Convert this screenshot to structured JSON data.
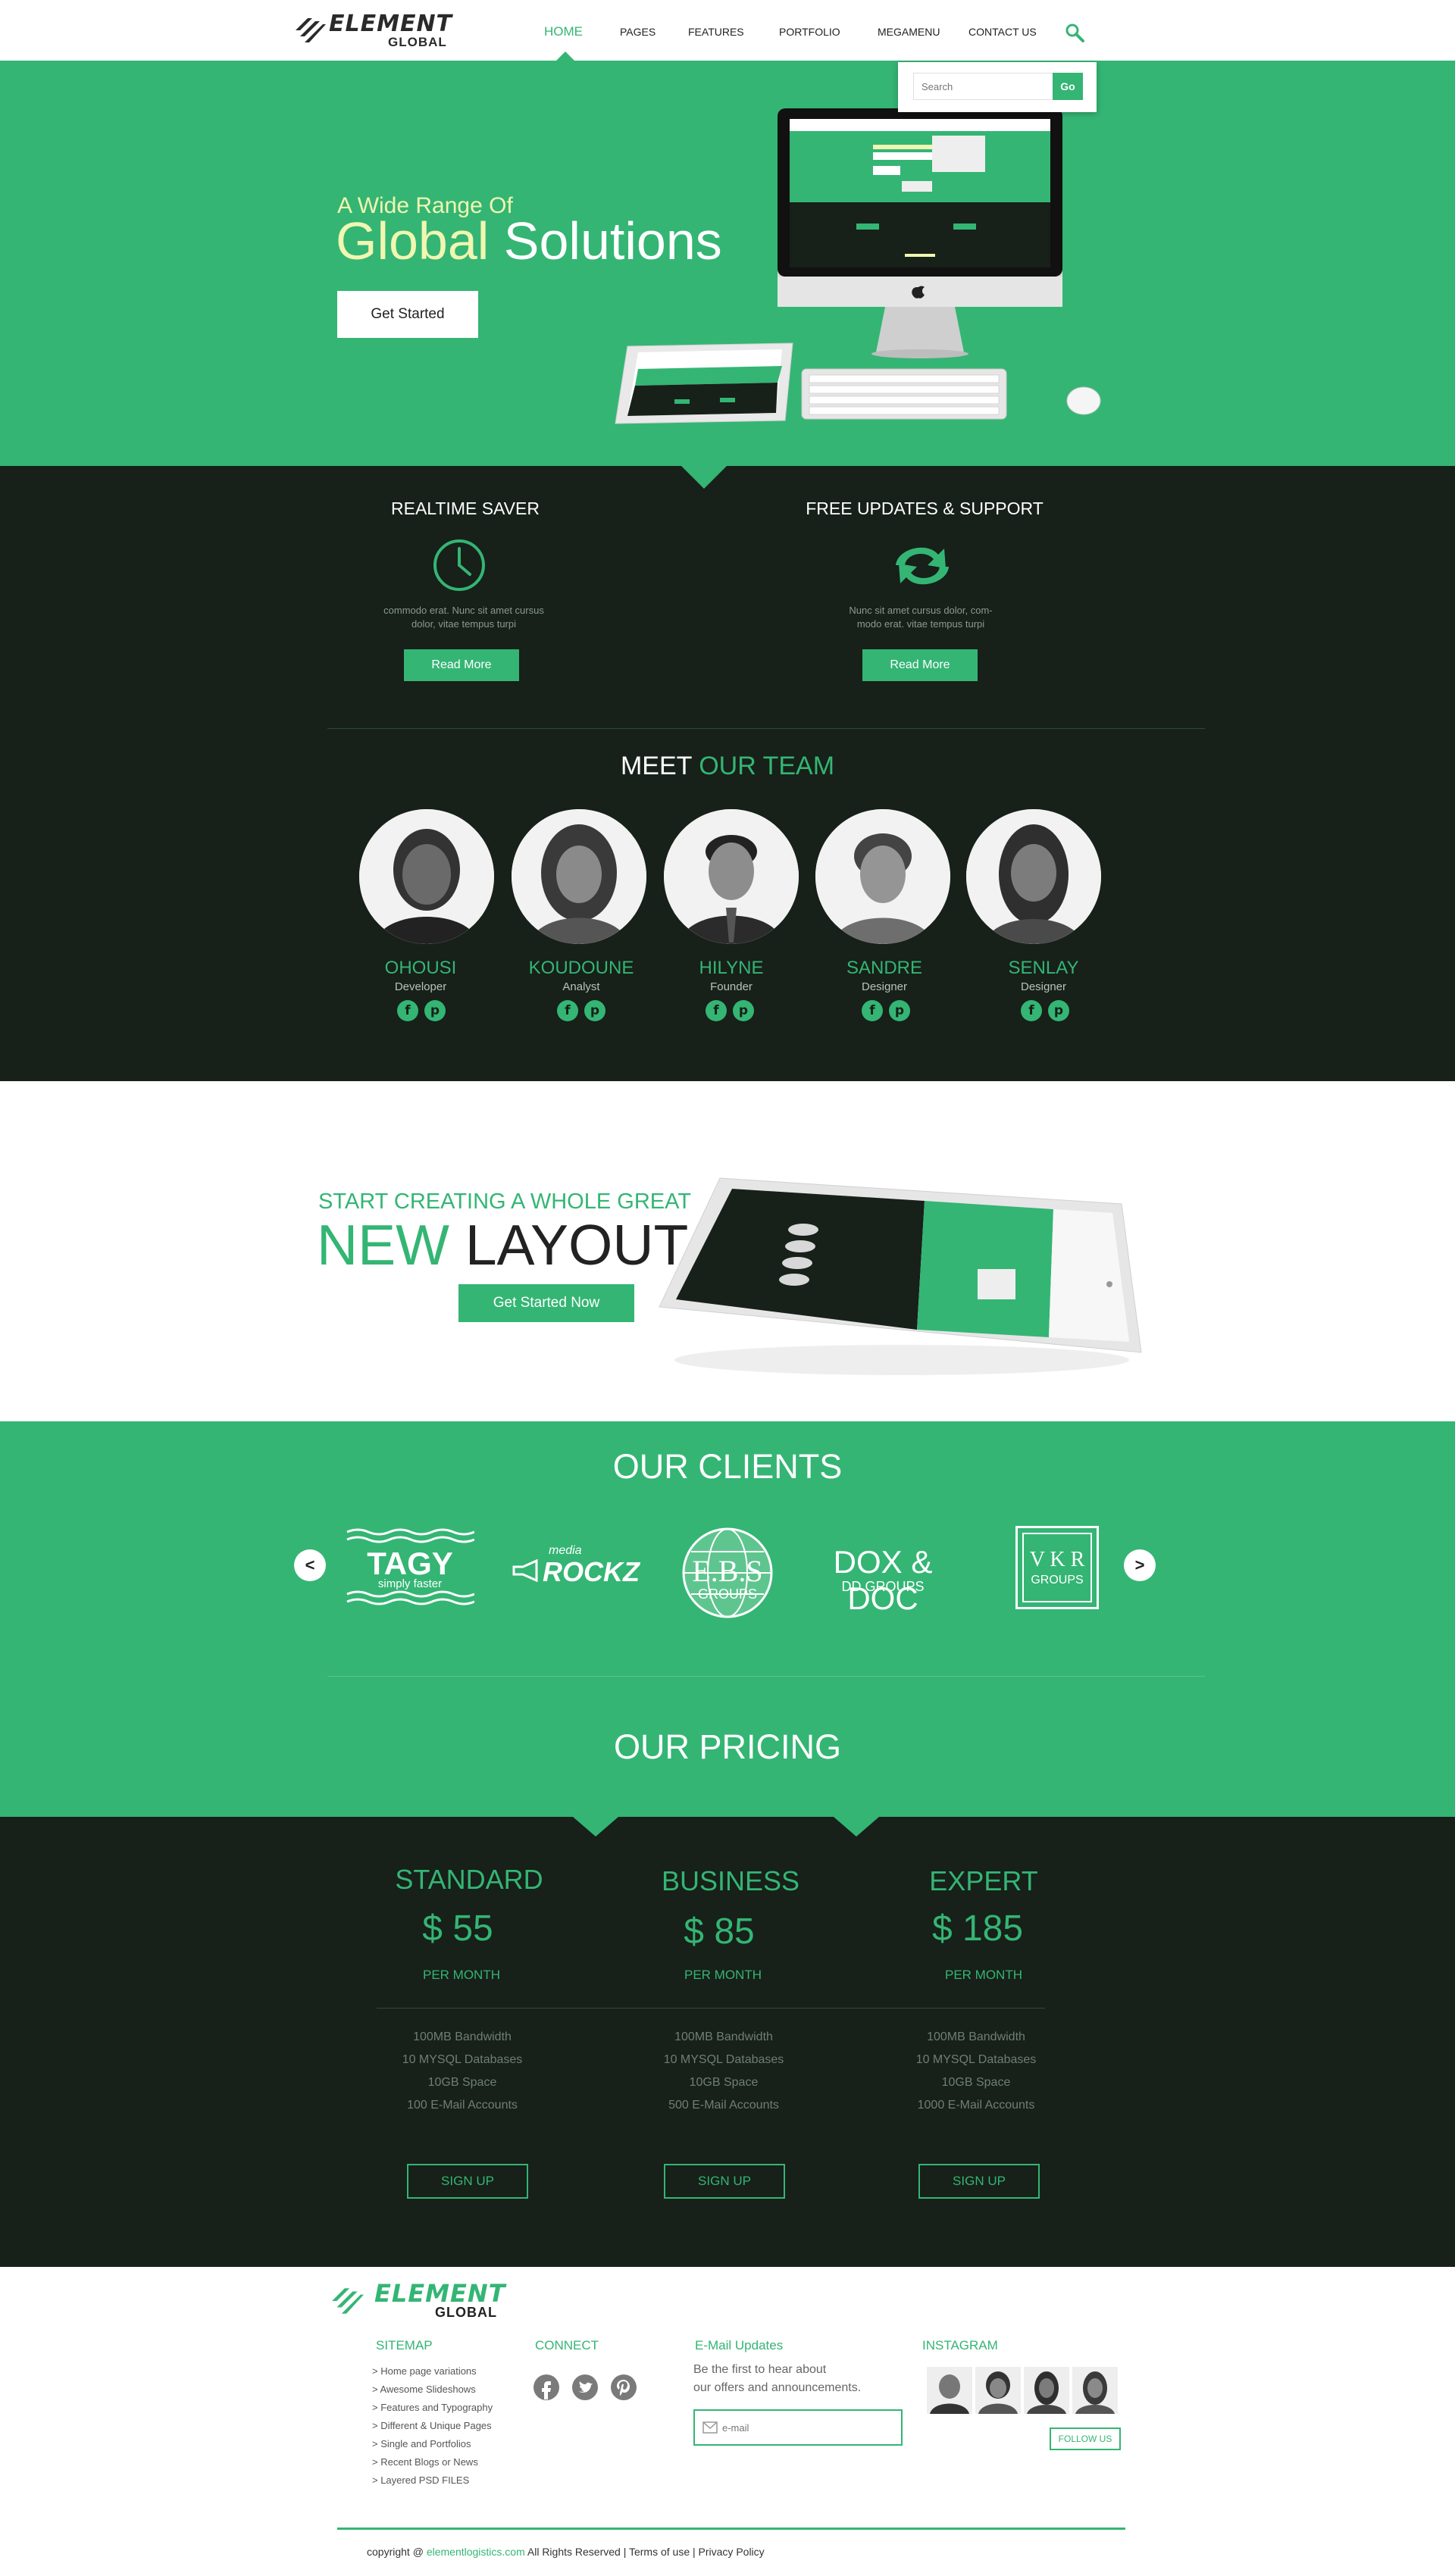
{
  "brand": {
    "name": "ELEMENT",
    "sub": "GLOBAL"
  },
  "nav": {
    "items": [
      "HOME",
      "PAGES",
      "FEATURES",
      "PORTFOLIO",
      "MEGAMENU",
      "CONTACT US"
    ],
    "search_placeholder": "Search",
    "search_button": "Go"
  },
  "hero": {
    "subtitle": "A Wide Range Of",
    "title_highlight": "Global",
    "title_rest": " Solutions",
    "button": "Get Started"
  },
  "features": [
    {
      "title": "REALTIME SAVER",
      "text": "commodo erat. Nunc sit amet cursus dolor, vitae tempus turpi",
      "button": "Read More",
      "icon": "clock-icon"
    },
    {
      "title": "FREE UPDATES & SUPPORT",
      "text": "Nunc sit amet cursus dolor, com-modo erat.  vitae tempus turpi",
      "button": "Read More",
      "icon": "refresh-icon"
    }
  ],
  "team": {
    "title_a": "MEET ",
    "title_b": "OUR TEAM",
    "members": [
      {
        "name": "OHOUSI",
        "role": "Developer"
      },
      {
        "name": "KOUDOUNE",
        "role": "Analyst"
      },
      {
        "name": "HILYNE",
        "role": "Founder"
      },
      {
        "name": "SANDRE",
        "role": "Designer"
      },
      {
        "name": "SENLAY",
        "role": "Designer"
      }
    ],
    "social": [
      "f",
      "p"
    ]
  },
  "promo": {
    "subtitle": "START CREATING A WHOLE GREAT",
    "title_a": "NEW",
    "title_b": " LAYOUT",
    "button": "Get Started Now"
  },
  "clients": {
    "title": "OUR CLIENTS",
    "prev": "<",
    "next": ">",
    "logos": [
      {
        "main": "TAGY",
        "sub": "simply faster"
      },
      {
        "main": "ROCKZ",
        "sub": "media"
      },
      {
        "main": "E.B.S",
        "sub": "GROUPS"
      },
      {
        "main": "DOX & DOC",
        "sub": "DD GROUPS"
      },
      {
        "main": "V K R",
        "sub": "GROUPS"
      }
    ]
  },
  "pricing": {
    "title": "OUR PRICING",
    "plans": [
      {
        "name": "STANDARD",
        "price": "$ 55",
        "period": "PER MONTH",
        "features": [
          "100MB Bandwidth",
          "10 MYSQL Databases",
          "10GB Space",
          "100 E-Mail Accounts"
        ],
        "button": "SIGN UP"
      },
      {
        "name": "BUSINESS",
        "price": "$ 85",
        "period": "PER MONTH",
        "features": [
          "100MB Bandwidth",
          "10 MYSQL Databases",
          "10GB Space",
          "500 E-Mail Accounts"
        ],
        "button": "SIGN UP"
      },
      {
        "name": "EXPERT",
        "price": "$ 185",
        "period": "PER MONTH",
        "features": [
          "100MB Bandwidth",
          "10 MYSQL Databases",
          "10GB Space",
          "1000 E-Mail Accounts"
        ],
        "button": "SIGN UP"
      }
    ]
  },
  "footer": {
    "sitemap_title": "SITEMAP",
    "sitemap": [
      "> Home page variations",
      "> Awesome Slideshows",
      "> Features and Typography",
      "> Different & Unique Pages",
      "> Single and Portfolios",
      "> Recent Blogs or News",
      "> Layered PSD FILES"
    ],
    "connect_title": "CONNECT",
    "email_title": "E-Mail Updates",
    "email_text_1": "Be the first to hear about",
    "email_text_2": "our offers and announcements.",
    "email_placeholder": "e-mail",
    "instagram_title": "INSTAGRAM",
    "follow": "FOLLOW US",
    "copyright_a": "copyright @ ",
    "copyright_link": "elementlogistics.com",
    "copyright_b": " All Rights Reserved  |  ",
    "terms": "Terms of use",
    "sep": "  |  ",
    "privacy": "Privacy Policy"
  },
  "colors": {
    "accent": "#34b574",
    "dark": "#172019",
    "highlight": "#f1f6b0"
  }
}
